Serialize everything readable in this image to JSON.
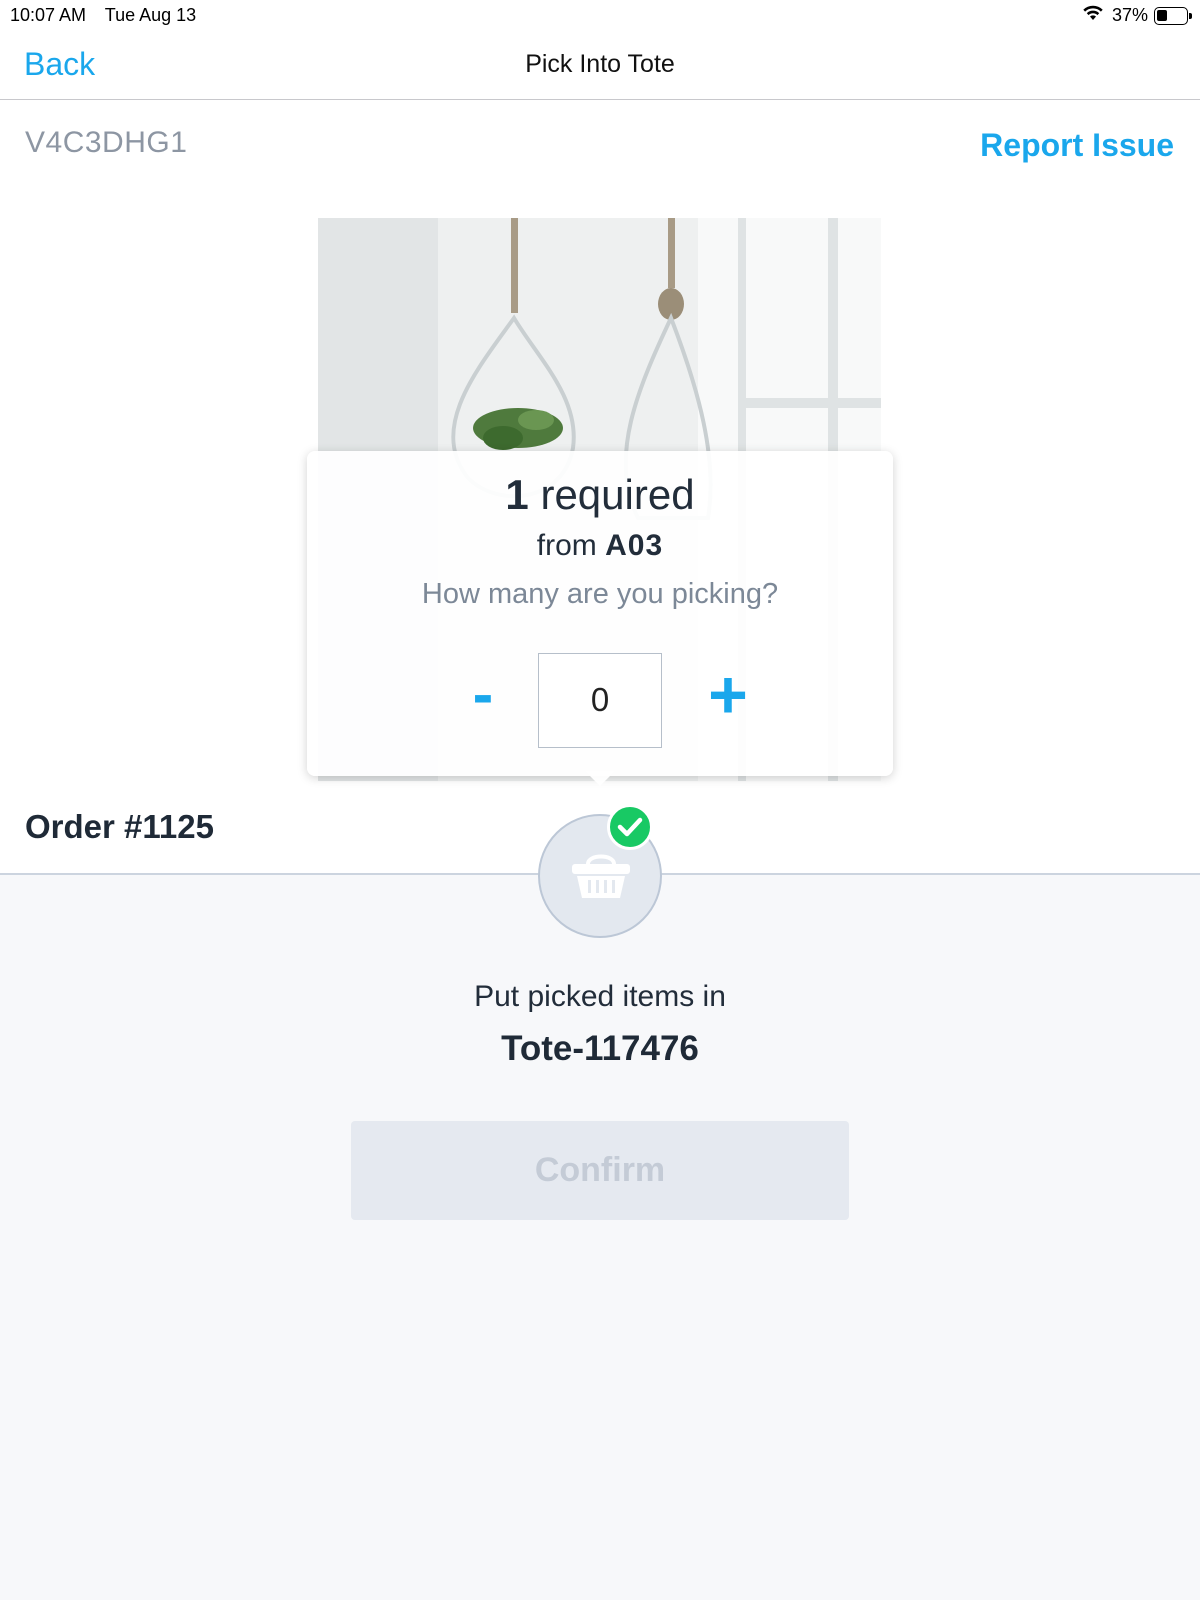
{
  "status_bar": {
    "time": "10:07 AM",
    "date": "Tue Aug 13",
    "battery": "37%",
    "battery_level": 0.37
  },
  "nav": {
    "back_label": "Back",
    "title": "Pick Into Tote"
  },
  "item": {
    "sku": "V4C3DHG1",
    "report_issue_label": "Report Issue"
  },
  "pick_prompt": {
    "required_count": "1",
    "required_suffix": "required",
    "from_prefix": "from",
    "location": "A03",
    "question": "How many are you picking?",
    "minus_label": "-",
    "plus_label": "+",
    "quantity": "0"
  },
  "order": {
    "label": "Order #1125"
  },
  "tote": {
    "instruction": "Put picked items in",
    "tote_id": "Tote-117476",
    "confirm_label": "Confirm"
  },
  "icons": {
    "tote": "basket-icon",
    "badge": "check-icon",
    "wifi": "wifi-icon",
    "battery": "battery-icon"
  },
  "colors": {
    "accent": "#1aa7ec",
    "success": "#18c964",
    "muted_text": "#8d96a3",
    "panel_bg": "#f7f8fa",
    "disabled_button": "#e5e9f0"
  }
}
